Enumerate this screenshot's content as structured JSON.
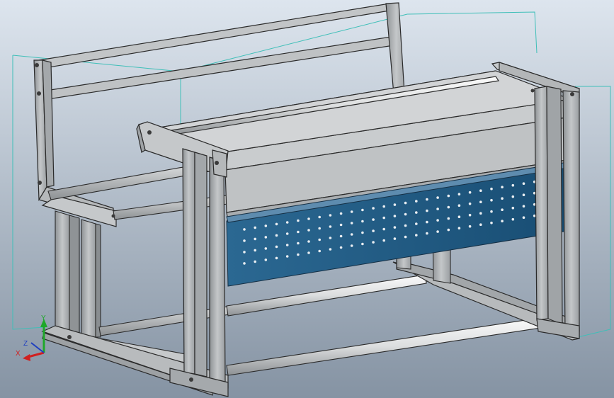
{
  "viewport": {
    "title": "",
    "background_top": "#dde5ee",
    "background_bottom": "#8593a3"
  },
  "model": {
    "name": "bench-frame-assembly",
    "frame_color": "#b9bcbe",
    "frame_edge": "#2a2a2a",
    "panel_color": "#1f5b85",
    "bar_color": "#e8e9ea",
    "bbox_color": "#3fbfb8"
  },
  "triad": {
    "x_label": "X",
    "y_label": "Y",
    "z_label": "Z",
    "x_color": "#d02020",
    "y_color": "#1fa82a",
    "z_color": "#1f3fbf"
  }
}
